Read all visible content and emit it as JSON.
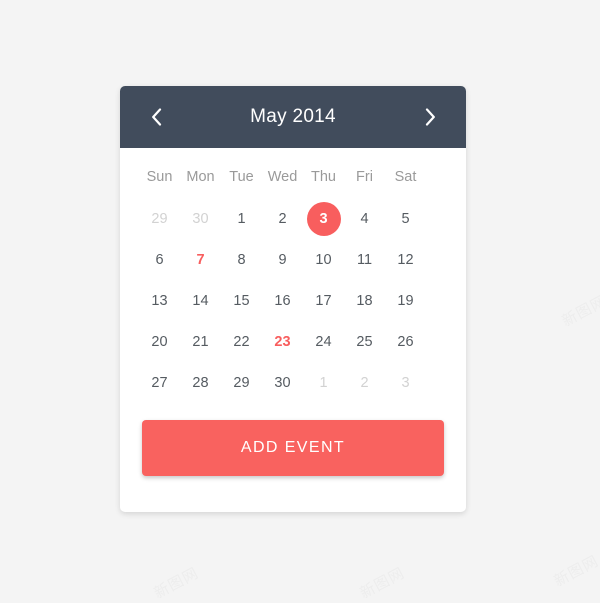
{
  "background": {
    "color": "#f4f4f4",
    "watermark_text": "新图网"
  },
  "colors": {
    "header_bg": "#414c5c",
    "accent_red": "#f85e5e",
    "button_red": "#f9625f",
    "card_bg": "#ffffff",
    "day_text": "#555b61",
    "muted_text": "#d2d2d2",
    "weekday_text": "#9a9a9a"
  },
  "header": {
    "title": "May 2014",
    "prev_icon": "chevron-left-icon",
    "next_icon": "chevron-right-icon"
  },
  "weekdays": [
    "Sun",
    "Mon",
    "Tue",
    "Wed",
    "Thu",
    "Fri",
    "Sat"
  ],
  "weeks": [
    [
      {
        "label": "29",
        "state": "muted"
      },
      {
        "label": "30",
        "state": "muted"
      },
      {
        "label": "1",
        "state": "normal"
      },
      {
        "label": "2",
        "state": "normal"
      },
      {
        "label": "3",
        "state": "selected"
      },
      {
        "label": "4",
        "state": "normal"
      },
      {
        "label": "5",
        "state": "normal"
      }
    ],
    [
      {
        "label": "6",
        "state": "normal"
      },
      {
        "label": "7",
        "state": "event"
      },
      {
        "label": "8",
        "state": "normal"
      },
      {
        "label": "9",
        "state": "normal"
      },
      {
        "label": "10",
        "state": "normal"
      },
      {
        "label": "11",
        "state": "normal"
      },
      {
        "label": "12",
        "state": "normal"
      }
    ],
    [
      {
        "label": "13",
        "state": "normal"
      },
      {
        "label": "14",
        "state": "normal"
      },
      {
        "label": "15",
        "state": "normal"
      },
      {
        "label": "16",
        "state": "normal"
      },
      {
        "label": "17",
        "state": "normal"
      },
      {
        "label": "18",
        "state": "normal"
      },
      {
        "label": "19",
        "state": "normal"
      }
    ],
    [
      {
        "label": "20",
        "state": "normal"
      },
      {
        "label": "21",
        "state": "normal"
      },
      {
        "label": "22",
        "state": "normal"
      },
      {
        "label": "23",
        "state": "event"
      },
      {
        "label": "24",
        "state": "normal"
      },
      {
        "label": "25",
        "state": "normal"
      },
      {
        "label": "26",
        "state": "normal"
      }
    ],
    [
      {
        "label": "27",
        "state": "normal"
      },
      {
        "label": "28",
        "state": "normal"
      },
      {
        "label": "29",
        "state": "normal"
      },
      {
        "label": "30",
        "state": "normal"
      },
      {
        "label": "1",
        "state": "muted"
      },
      {
        "label": "2",
        "state": "muted"
      },
      {
        "label": "3",
        "state": "muted"
      }
    ]
  ],
  "footer": {
    "add_event_label": "ADD EVENT"
  }
}
